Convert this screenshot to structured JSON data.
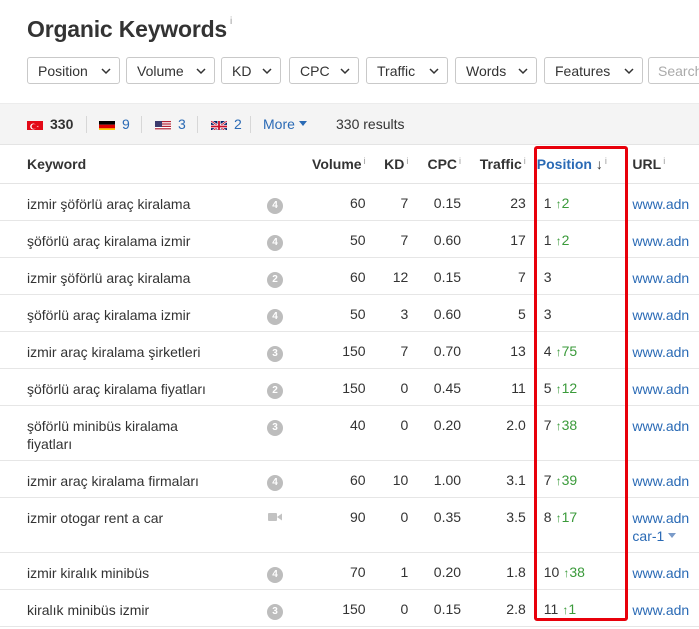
{
  "page_title": "Organic Keywords",
  "title_info": "i",
  "filters": [
    {
      "label": "Position"
    },
    {
      "label": "Volume"
    },
    {
      "label": "KD"
    },
    {
      "label": "CPC"
    },
    {
      "label": "Traffic"
    },
    {
      "label": "Words"
    },
    {
      "label": "Features"
    }
  ],
  "search": {
    "placeholder": "Search"
  },
  "countries": [
    {
      "flag": "tr",
      "count": "330",
      "active": true
    },
    {
      "flag": "de",
      "count": "9"
    },
    {
      "flag": "us",
      "count": "3"
    },
    {
      "flag": "gb",
      "count": "2"
    }
  ],
  "more_label": "More",
  "results_text": "330 results",
  "columns": {
    "keyword": "Keyword",
    "volume": "Volume",
    "kd": "KD",
    "cpc": "CPC",
    "traffic": "Traffic",
    "position": "Position",
    "position_sort": "↓",
    "url": "URL",
    "info": "i"
  },
  "rows": [
    {
      "keyword": "izmir şöförlü araç kiralama",
      "sf": "4",
      "volume": "60",
      "kd": "7",
      "cpc": "0.15",
      "traffic": "23",
      "position": "1",
      "change": "2",
      "url": "www.adn"
    },
    {
      "keyword": "şöförlü araç kiralama izmir",
      "sf": "4",
      "volume": "50",
      "kd": "7",
      "cpc": "0.60",
      "traffic": "17",
      "position": "1",
      "change": "2",
      "url": "www.adn"
    },
    {
      "keyword": "izmir şöförlü araç kiralama",
      "sf": "2",
      "volume": "60",
      "kd": "12",
      "cpc": "0.15",
      "traffic": "7",
      "position": "3",
      "change": "",
      "url": "www.adn"
    },
    {
      "keyword": "şöförlü araç kiralama izmir",
      "sf": "4",
      "volume": "50",
      "kd": "3",
      "cpc": "0.60",
      "traffic": "5",
      "position": "3",
      "change": "",
      "url": "www.adn"
    },
    {
      "keyword": "izmir araç kiralama şirketleri",
      "sf": "3",
      "volume": "150",
      "kd": "7",
      "cpc": "0.70",
      "traffic": "13",
      "position": "4",
      "change": "75",
      "url": "www.adn"
    },
    {
      "keyword": "şöförlü araç kiralama fiyatları",
      "sf": "2",
      "volume": "150",
      "kd": "0",
      "cpc": "0.45",
      "traffic": "11",
      "position": "5",
      "change": "12",
      "url": "www.adn"
    },
    {
      "keyword": "şöförlü minibüs kiralama fiyatları",
      "sf": "3",
      "volume": "40",
      "kd": "0",
      "cpc": "0.20",
      "traffic": "2.0",
      "position": "7",
      "change": "38",
      "url": "www.adn"
    },
    {
      "keyword": "izmir araç kiralama firmaları",
      "sf": "4",
      "volume": "60",
      "kd": "10",
      "cpc": "1.00",
      "traffic": "3.1",
      "position": "7",
      "change": "39",
      "url": "www.adn"
    },
    {
      "keyword": "izmir otogar rent a car",
      "sf": "video",
      "volume": "90",
      "kd": "0",
      "cpc": "0.35",
      "traffic": "3.5",
      "position": "8",
      "change": "17",
      "url": "www.adn",
      "url2": "car-1"
    },
    {
      "keyword": "izmir kiralık minibüs",
      "sf": "4",
      "volume": "70",
      "kd": "1",
      "cpc": "0.20",
      "traffic": "1.8",
      "position": "10",
      "change": "38",
      "url": "www.adn"
    },
    {
      "keyword": "kiralık minibüs izmir",
      "sf": "3",
      "volume": "150",
      "kd": "0",
      "cpc": "0.15",
      "traffic": "2.8",
      "position": "11",
      "change": "1",
      "url": "www.adn"
    }
  ],
  "colors": {
    "accent": "#2a6ab5",
    "positive": "#3a9a3a",
    "highlight": "#e8000b"
  }
}
